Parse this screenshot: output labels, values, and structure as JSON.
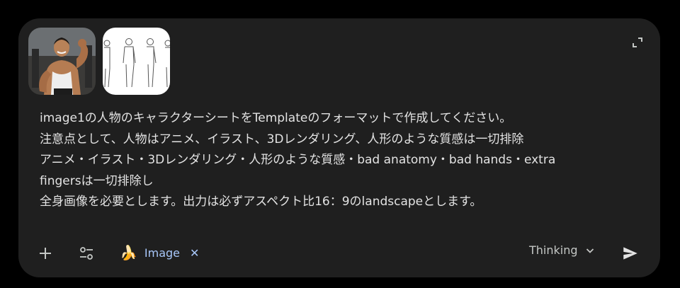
{
  "attachments": [
    {
      "name": "image1-muscular-man-photo",
      "icon": "photo-thumbnail"
    },
    {
      "name": "image2-template-sketch",
      "icon": "sketch-thumbnail"
    }
  ],
  "prompt": {
    "lines": [
      "image1の人物のキャラクターシートをTemplateのフォーマットで作成してください。",
      "注意点として、人物はアニメ、イラスト、3Dレンダリング、人形のような質感は一切排除",
      "アニメ・イラスト・3Dレンダリング・人形のような質感・bad anatomy・bad hands・extra",
      "fingersは一切排除し",
      "全身画像を必要とします。出力は必ずアスペクト比16：9のlandscapeとします。"
    ]
  },
  "toolbar": {
    "tool_chip": {
      "emoji": "🍌",
      "label": "Image",
      "close_glyph": "✕"
    },
    "mode": {
      "label": "Thinking"
    }
  },
  "colors": {
    "background": "#000000",
    "card": "#1f1f1f",
    "text": "#e3e3e3",
    "accent": "#a8c7fa"
  }
}
